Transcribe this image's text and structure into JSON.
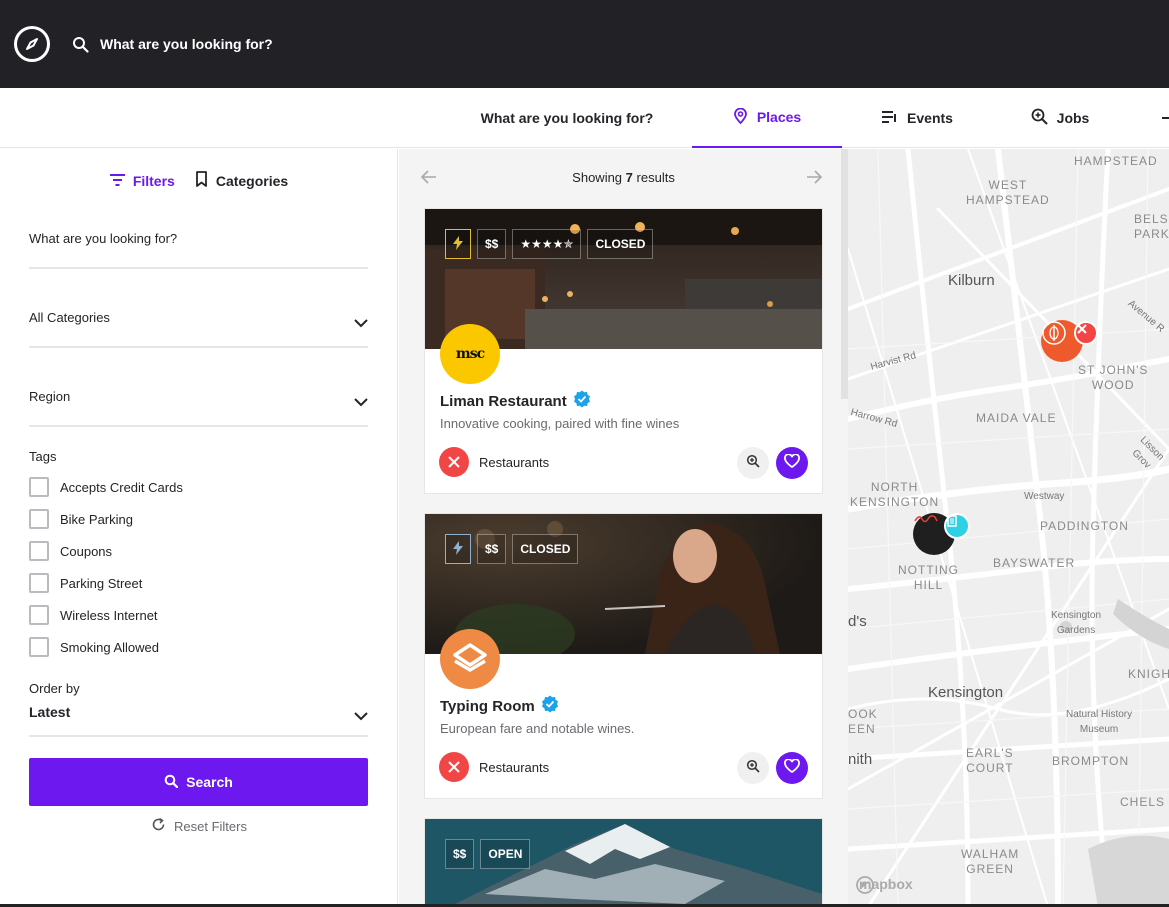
{
  "topbar": {
    "search_placeholder": "What are you looking for?"
  },
  "tabs": [
    {
      "label": "What are you looking for?"
    },
    {
      "label": "Places"
    },
    {
      "label": "Events"
    },
    {
      "label": "Jobs"
    }
  ],
  "sidebar": {
    "tab_filters": "Filters",
    "tab_categories": "Categories",
    "keyword_placeholder": "What are you looking for?",
    "category_select": "All Categories",
    "region_select": "Region",
    "tags_label": "Tags",
    "tags": [
      "Accepts Credit Cards",
      "Bike Parking",
      "Coupons",
      "Parking Street",
      "Wireless Internet",
      "Smoking Allowed"
    ],
    "order_label": "Order by",
    "order_value": "Latest",
    "search_button": "Search",
    "reset_label": "Reset Filters"
  },
  "results": {
    "prefix": "Showing",
    "count": "7",
    "suffix": "results"
  },
  "cards": [
    {
      "badges": [
        "$$",
        "CLOSED"
      ],
      "rating_stars": "★★★★✯",
      "avatar_text": "msc",
      "title": "Liman Restaurant",
      "description": "Innovative cooking, paired with fine wines",
      "category": "Restaurants"
    },
    {
      "badges": [
        "$$",
        "CLOSED"
      ],
      "title": "Typing Room",
      "description": "European fare and notable wines.",
      "category": "Restaurants"
    },
    {
      "badges": [
        "$$",
        "OPEN"
      ]
    }
  ],
  "map": {
    "labels": [
      "HAMPSTEAD",
      "WEST\nHAMPSTEAD",
      "BELSIZ\nPARK",
      "Kilburn",
      "Avenue R",
      "Harvist Rd",
      "ST JOHN'S\nWOOD",
      "Harrow Rd",
      "MAIDA VALE",
      "Lisson Grov",
      "NORTH\nKENSINGTON",
      "Westway",
      "PADDINGTON",
      "NOTTING\nHILL",
      "BAYSWATER",
      "Kensington\nGardens",
      "KNIGHTS",
      "Kensington",
      "Natural History\nMuseum",
      "OOK\nEEN",
      "EARL'S\nCOURT",
      "BROMPTON",
      "nith",
      "CHELS",
      "WALHAM\nGREEN",
      "d's"
    ],
    "attribution": "mapbox"
  },
  "colors": {
    "accent": "#6d18ef",
    "topbar": "#222226",
    "category_red": "#f24646",
    "verified": "#1aa3e8"
  }
}
